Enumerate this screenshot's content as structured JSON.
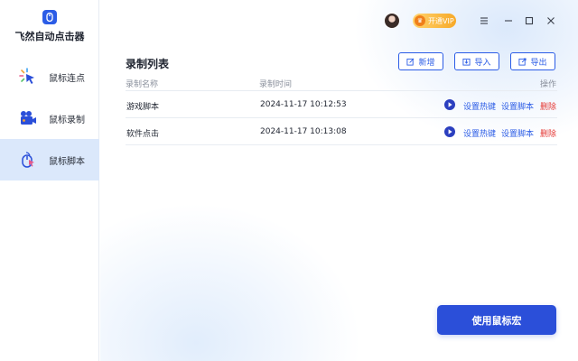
{
  "app": {
    "title": "飞然自动点击器"
  },
  "sidebar": {
    "items": [
      {
        "label": "鼠标连点",
        "icon": "click-icon",
        "active": false
      },
      {
        "label": "鼠标录制",
        "icon": "video-camera-icon",
        "active": false
      },
      {
        "label": "鼠标脚本",
        "icon": "mouse-icon",
        "active": true
      }
    ]
  },
  "titlebar": {
    "vip_label": "开通VIP",
    "vip_icon": "crown-icon"
  },
  "main": {
    "section_title": "录制列表",
    "toolbar": {
      "new_label": "新增",
      "import_label": "导入",
      "export_label": "导出"
    },
    "table": {
      "columns": [
        "录制名称",
        "录制时间",
        "操作"
      ],
      "rows": [
        {
          "name": "游戏脚本",
          "time": "2024-11-17 10:12:53"
        },
        {
          "name": "软件点击",
          "time": "2024-11-17 10:13:08"
        }
      ],
      "actions": {
        "hotkey": "设置热键",
        "script": "设置脚本",
        "delete": "删除"
      }
    },
    "primary_button": "使用鼠标宏"
  },
  "colors": {
    "accent": "#2b5ce6",
    "primary_button": "#2b4fd9",
    "danger": "#e53935",
    "sidebar_active": "#dbe8fb",
    "vip_gold": "#f7a928"
  }
}
